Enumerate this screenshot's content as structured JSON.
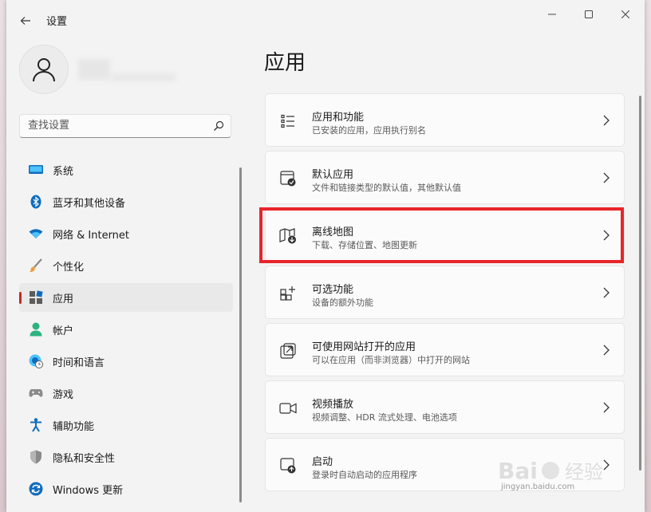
{
  "window": {
    "title": "设置"
  },
  "user": {
    "name": ""
  },
  "search": {
    "placeholder": "查找设置"
  },
  "nav": {
    "items": [
      {
        "label": "系统"
      },
      {
        "label": "蓝牙和其他设备"
      },
      {
        "label": "网络 & Internet"
      },
      {
        "label": "个性化"
      },
      {
        "label": "应用",
        "active": true
      },
      {
        "label": "帐户"
      },
      {
        "label": "时间和语言"
      },
      {
        "label": "游戏"
      },
      {
        "label": "辅助功能"
      },
      {
        "label": "隐私和安全性"
      },
      {
        "label": "Windows 更新"
      }
    ]
  },
  "main": {
    "title": "应用",
    "cards": [
      {
        "title": "应用和功能",
        "subtitle": "已安装的应用，应用执行别名"
      },
      {
        "title": "默认应用",
        "subtitle": "文件和链接类型的默认值，其他默认值"
      },
      {
        "title": "离线地图",
        "subtitle": "下载、存储位置、地图更新",
        "highlighted": true
      },
      {
        "title": "可选功能",
        "subtitle": "设备的额外功能"
      },
      {
        "title": "可使用网站打开的应用",
        "subtitle": "可以在应用（而非浏览器）中打开的网站"
      },
      {
        "title": "视频播放",
        "subtitle": "视频调整、HDR 流式处理、电池选项"
      },
      {
        "title": "启动",
        "subtitle": "登录时自动启动的应用程序"
      }
    ]
  },
  "watermark": {
    "brand": "Bai 经验",
    "url": "jingyan.baidu.com"
  },
  "colors": {
    "accent": "#c42b1c",
    "highlight": "#e8252a"
  }
}
